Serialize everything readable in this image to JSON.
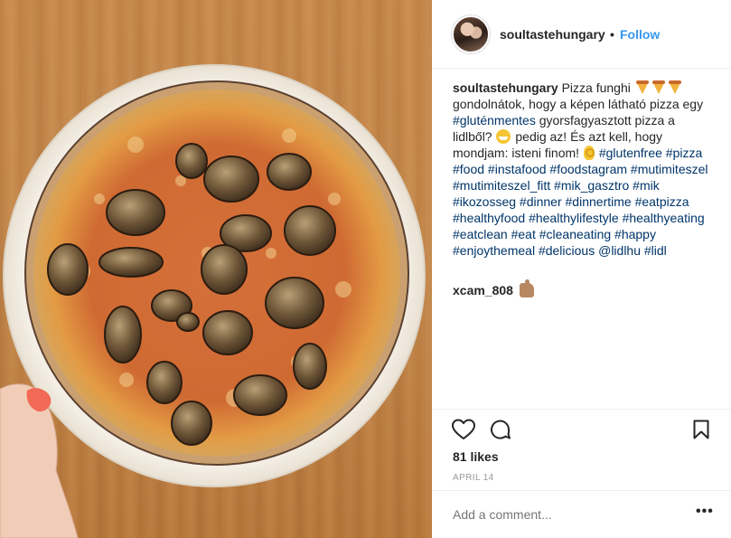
{
  "post": {
    "username": "soultastehungary",
    "follow_label": "Follow",
    "separator": "•",
    "caption": {
      "part1": "Pizza funghi",
      "part2": "gondolnátok, hogy a képen látható pizza egy",
      "tag_glutenmentes": "#gluténmentes",
      "part3": "gyorsfagyasztott pizza a lidlből?",
      "part4": "pedig az! És azt kell, hogy mondjam: isteni finom!",
      "tags": "#glutenfree #pizza #food #instafood #foodstagram #mutimiteszel #mutimiteszel_fitt #mik_gasztro #mik #ikozosseg #dinner #dinnertime #eatpizza #healthyfood #healthylifestyle #healthyeating #eatclean #eat #cleaneating #happy #enjoythemeal #delicious @lidlhu #lidl"
    },
    "comment": {
      "username": "xcam_808"
    },
    "likes": "81 likes",
    "date": "APRIL 14",
    "add_comment_placeholder": "Add a comment...",
    "more_label": "•••"
  },
  "icons": [
    "heart-icon",
    "comment-icon",
    "bookmark-icon",
    "pizza-emoji",
    "grin-emoji",
    "ok-hand-emoji",
    "thumbs-up-emoji"
  ],
  "colors": {
    "link": "#3897f0",
    "hashtag": "#003569",
    "text": "#262626",
    "muted": "#999999",
    "divider": "#efefef"
  }
}
